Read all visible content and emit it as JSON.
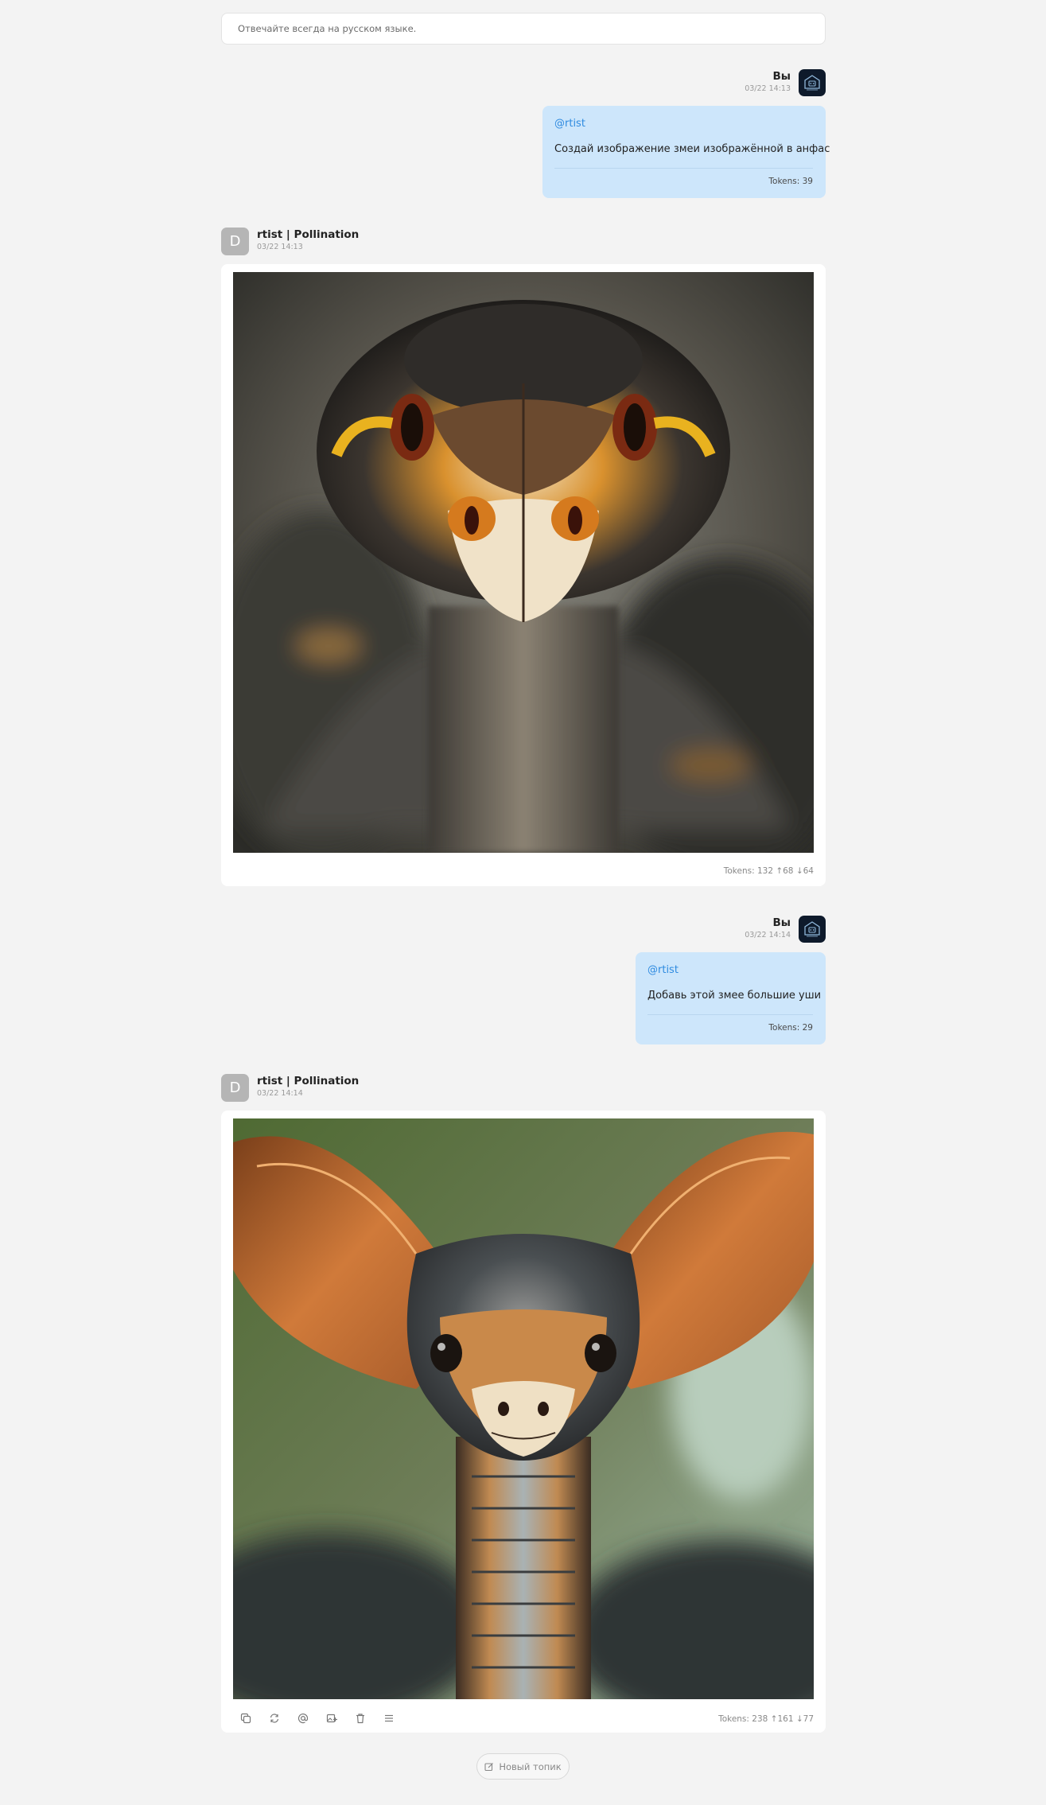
{
  "system_prompt": "Отвечайте всегда на русском языке.",
  "messages": [
    {
      "role": "user",
      "name": "Вы",
      "time": "03/22 14:13",
      "mention": "@rtist",
      "text": "Создай изображение змеи изображённой в анфас",
      "tokens": "Tokens: 39",
      "avatar_icon": "robot-house-icon"
    },
    {
      "role": "assistant",
      "avatar_letter": "D",
      "name": "rtist | Pollination",
      "time": "03/22 14:13",
      "image": "snake-front-portrait",
      "tokens": "Tokens: 132 ↑68 ↓64"
    },
    {
      "role": "user",
      "name": "Вы",
      "time": "03/22 14:14",
      "mention": "@rtist",
      "text": "Добавь этой змее большие уши",
      "tokens": "Tokens: 29",
      "avatar_icon": "robot-house-icon"
    },
    {
      "role": "assistant",
      "avatar_letter": "D",
      "name": "rtist | Pollination",
      "time": "03/22 14:14",
      "image": "snake-with-big-ears",
      "tokens": "Tokens: 238 ↑161 ↓77",
      "actions": [
        "copy-icon",
        "regenerate-icon",
        "mention-icon",
        "image-add-icon",
        "trash-icon",
        "menu-icon"
      ]
    }
  ],
  "new_topic_label": "Новый топик",
  "colors": {
    "background": "#f3f3f3",
    "user_bubble": "#cde6fb",
    "mention": "#2f8be0",
    "bot_avatar": "#b5b5b5"
  }
}
